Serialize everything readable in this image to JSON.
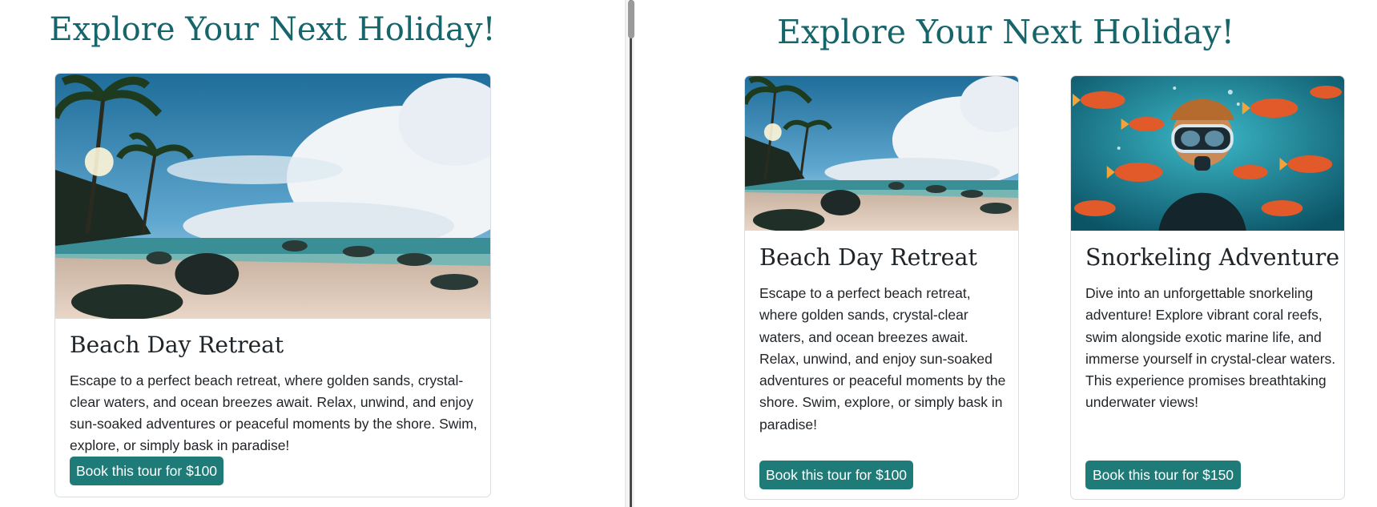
{
  "panes": {
    "left": {
      "heading": "Explore Your Next Holiday!",
      "cards": [
        {
          "title": "Beach Day Retreat",
          "description": "Escape to a perfect beach retreat, where golden sands, crystal-clear waters, and ocean breezes await. Relax, unwind, and enjoy sun-soaked adventures or peaceful moments by the shore. Swim, explore, or simply bask in paradise!",
          "button_label": "Book this tour for $100",
          "image_icon": "beach-photo"
        }
      ]
    },
    "right": {
      "heading": "Explore Your Next Holiday!",
      "cards": [
        {
          "title": "Beach Day Retreat",
          "description": "Escape to a perfect beach retreat, where golden sands, crystal-clear waters, and ocean breezes await. Relax, unwind, and enjoy sun-soaked adventures or peaceful moments by the shore. Swim, explore, or simply bask in paradise!",
          "button_label": "Book this tour for $100",
          "image_icon": "beach-photo"
        },
        {
          "title": "Snorkeling Adventure",
          "description": "Dive into an unforgettable snorkeling adventure! Explore vibrant coral reefs, swim alongside exotic marine life, and immerse yourself in crystal-clear waters. This experience promises breathtaking underwater views!",
          "button_label": "Book this tour for $150",
          "image_icon": "snorkel-photo"
        }
      ]
    }
  },
  "colors": {
    "heading": "#16656b",
    "button": "#1f7b78",
    "card_border": "#d9dee2"
  }
}
